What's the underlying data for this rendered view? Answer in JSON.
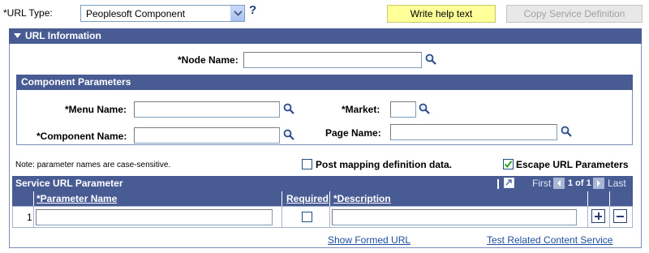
{
  "url_type": {
    "label": "*URL Type:",
    "value": "Peoplesoft Component",
    "help_glyph": "?"
  },
  "buttons": {
    "write_help": "Write help text",
    "copy_service": "Copy Service Definition"
  },
  "url_info": {
    "title": "URL Information",
    "node_name_label": "*Node Name:",
    "node_name_value": ""
  },
  "component_params": {
    "title": "Component Parameters",
    "menu_name_label": "*Menu Name:",
    "market_label": "*Market:",
    "component_name_label": "*Component Name:",
    "page_name_label": "Page Name:"
  },
  "options": {
    "note": "Note: parameter names are case-sensitive.",
    "post_mapping_label": "Post mapping definition data.",
    "post_mapping_checked": false,
    "escape_url_label": "Escape URL Parameters",
    "escape_url_checked": true
  },
  "service_grid": {
    "title": "Service URL Parameter",
    "first": "First",
    "range": "1 of 1",
    "last": "Last",
    "columns": [
      "*Parameter Name",
      "Required",
      "*Description"
    ],
    "rows": [
      {
        "num": "1",
        "param_name": "",
        "required": false,
        "description": ""
      }
    ]
  },
  "links": {
    "show_formed_url": "Show Formed URL",
    "test_related": "Test Related Content Service"
  },
  "colors": {
    "header_bg": "#485c93",
    "link": "#1c4e9c",
    "help_button_bg": "#ffff99"
  }
}
